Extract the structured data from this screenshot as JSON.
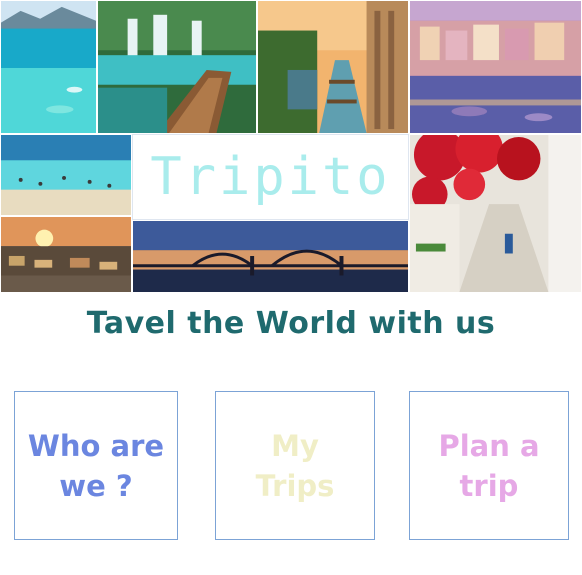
{
  "brand": {
    "name": "Tripito",
    "tagline": "Tavel the World with us"
  },
  "colors": {
    "logo": "#a9ecec",
    "tagline": "#1f6a6e",
    "card_border": "#7ca3d6",
    "about": "#6b86e0",
    "trips": "#f0eec6",
    "plan": "#e6a8e6"
  },
  "collage": {
    "tiles": [
      "tropical-beach-photo",
      "waterfall-boardwalk-photo",
      "canal-locks-city-photo",
      "harbor-town-photo",
      "crowded-beach-photo",
      "sunset-market-photo",
      "bridge-at-dusk-photo",
      "flowered-alley-photo"
    ]
  },
  "nav": {
    "about": "Who are\nwe ?",
    "trips": "My\nTrips",
    "plan": "Plan a\ntrip"
  }
}
